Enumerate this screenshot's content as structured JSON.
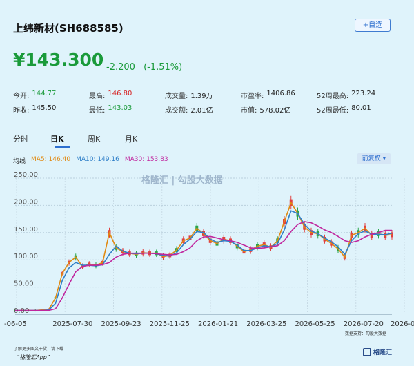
{
  "header": {
    "title": "上纬新材(SH688585)",
    "add_watch": "+自选"
  },
  "quote": {
    "price": "¥143.300",
    "change": "-2.200",
    "change_pct": "(-1.51%)"
  },
  "stats": {
    "row1": [
      {
        "label": "今开:",
        "value": "144.77",
        "color": "green"
      },
      {
        "label": "最高:",
        "value": "146.80",
        "color": "red"
      },
      {
        "label": "成交量:",
        "value": "1.39万",
        "color": "dark"
      },
      {
        "label": "市盈率:",
        "value": "1406.86",
        "color": "dark"
      },
      {
        "label": "52周最高:",
        "value": "223.24",
        "color": "dark"
      }
    ],
    "row2": [
      {
        "label": "昨收:",
        "value": "145.50",
        "color": "dark"
      },
      {
        "label": "最低:",
        "value": "143.03",
        "color": "green"
      },
      {
        "label": "成交额:",
        "value": "2.01亿",
        "color": "dark"
      },
      {
        "label": "市值:",
        "value": "578.02亿",
        "color": "dark"
      },
      {
        "label": "52周最低:",
        "value": "80.01",
        "color": "dark"
      }
    ]
  },
  "tabs": [
    "分时",
    "日K",
    "周K",
    "月K"
  ],
  "active_tab": "日K",
  "ma_legend": {
    "label": "均线",
    "ma5": "MA5: 146.40",
    "ma10": "MA10: 149.16",
    "ma30": "MA30: 153.83"
  },
  "adjust_label": "前复权",
  "watermark": "格隆汇 | 勾股大数据",
  "chart_data": {
    "type": "line",
    "y_ticks": [
      "250.00",
      "200.00",
      "150.00",
      "100.00",
      "50.00",
      "0.00"
    ],
    "ylim": [
      0,
      250
    ],
    "x_ticks": [
      "-06-05",
      "2025-07-30",
      "2025-09-23",
      "2025-11-25",
      "2026-01-21",
      "2026-03-25",
      "2026-05-25",
      "2026-07-20",
      "2026-0"
    ],
    "grid": true,
    "series": [
      {
        "name": "MA5",
        "color": "#e08a12",
        "values": [
          7,
          7,
          7,
          7,
          8,
          9,
          30,
          75,
          95,
          105,
          88,
          92,
          90,
          95,
          150,
          122,
          115,
          112,
          110,
          113,
          112,
          112,
          106,
          108,
          118,
          135,
          140,
          158,
          148,
          135,
          130,
          138,
          135,
          125,
          115,
          118,
          125,
          128,
          123,
          135,
          170,
          205,
          185,
          160,
          150,
          148,
          138,
          130,
          120,
          105,
          145,
          150,
          158,
          145,
          148,
          145,
          146
        ]
      },
      {
        "name": "MA10",
        "color": "#2f7fc8",
        "values": [
          7,
          7,
          7,
          7,
          7,
          8,
          20,
          62,
          85,
          95,
          90,
          90,
          89,
          91,
          110,
          125,
          116,
          112,
          111,
          112,
          112,
          111,
          108,
          107,
          113,
          128,
          138,
          152,
          150,
          138,
          132,
          135,
          134,
          127,
          117,
          117,
          122,
          126,
          124,
          130,
          155,
          190,
          185,
          165,
          153,
          148,
          140,
          133,
          124,
          110,
          135,
          148,
          153,
          147,
          147,
          146,
          149
        ]
      },
      {
        "name": "MA30",
        "color": "#c0269e",
        "values": [
          7,
          7,
          7,
          7,
          7,
          7,
          10,
          30,
          55,
          78,
          88,
          90,
          90,
          91,
          95,
          105,
          110,
          112,
          112,
          112,
          112,
          111,
          110,
          109,
          110,
          115,
          122,
          135,
          142,
          143,
          140,
          137,
          135,
          132,
          127,
          122,
          121,
          122,
          124,
          126,
          135,
          152,
          165,
          170,
          168,
          162,
          155,
          150,
          143,
          135,
          132,
          135,
          142,
          147,
          150,
          154,
          154
        ]
      }
    ]
  },
  "footer": {
    "text": "了解更多图文干货，请下载",
    "app": "“格隆汇App”",
    "logo": "格隆汇",
    "source": "数据支持：勾股大数据"
  }
}
